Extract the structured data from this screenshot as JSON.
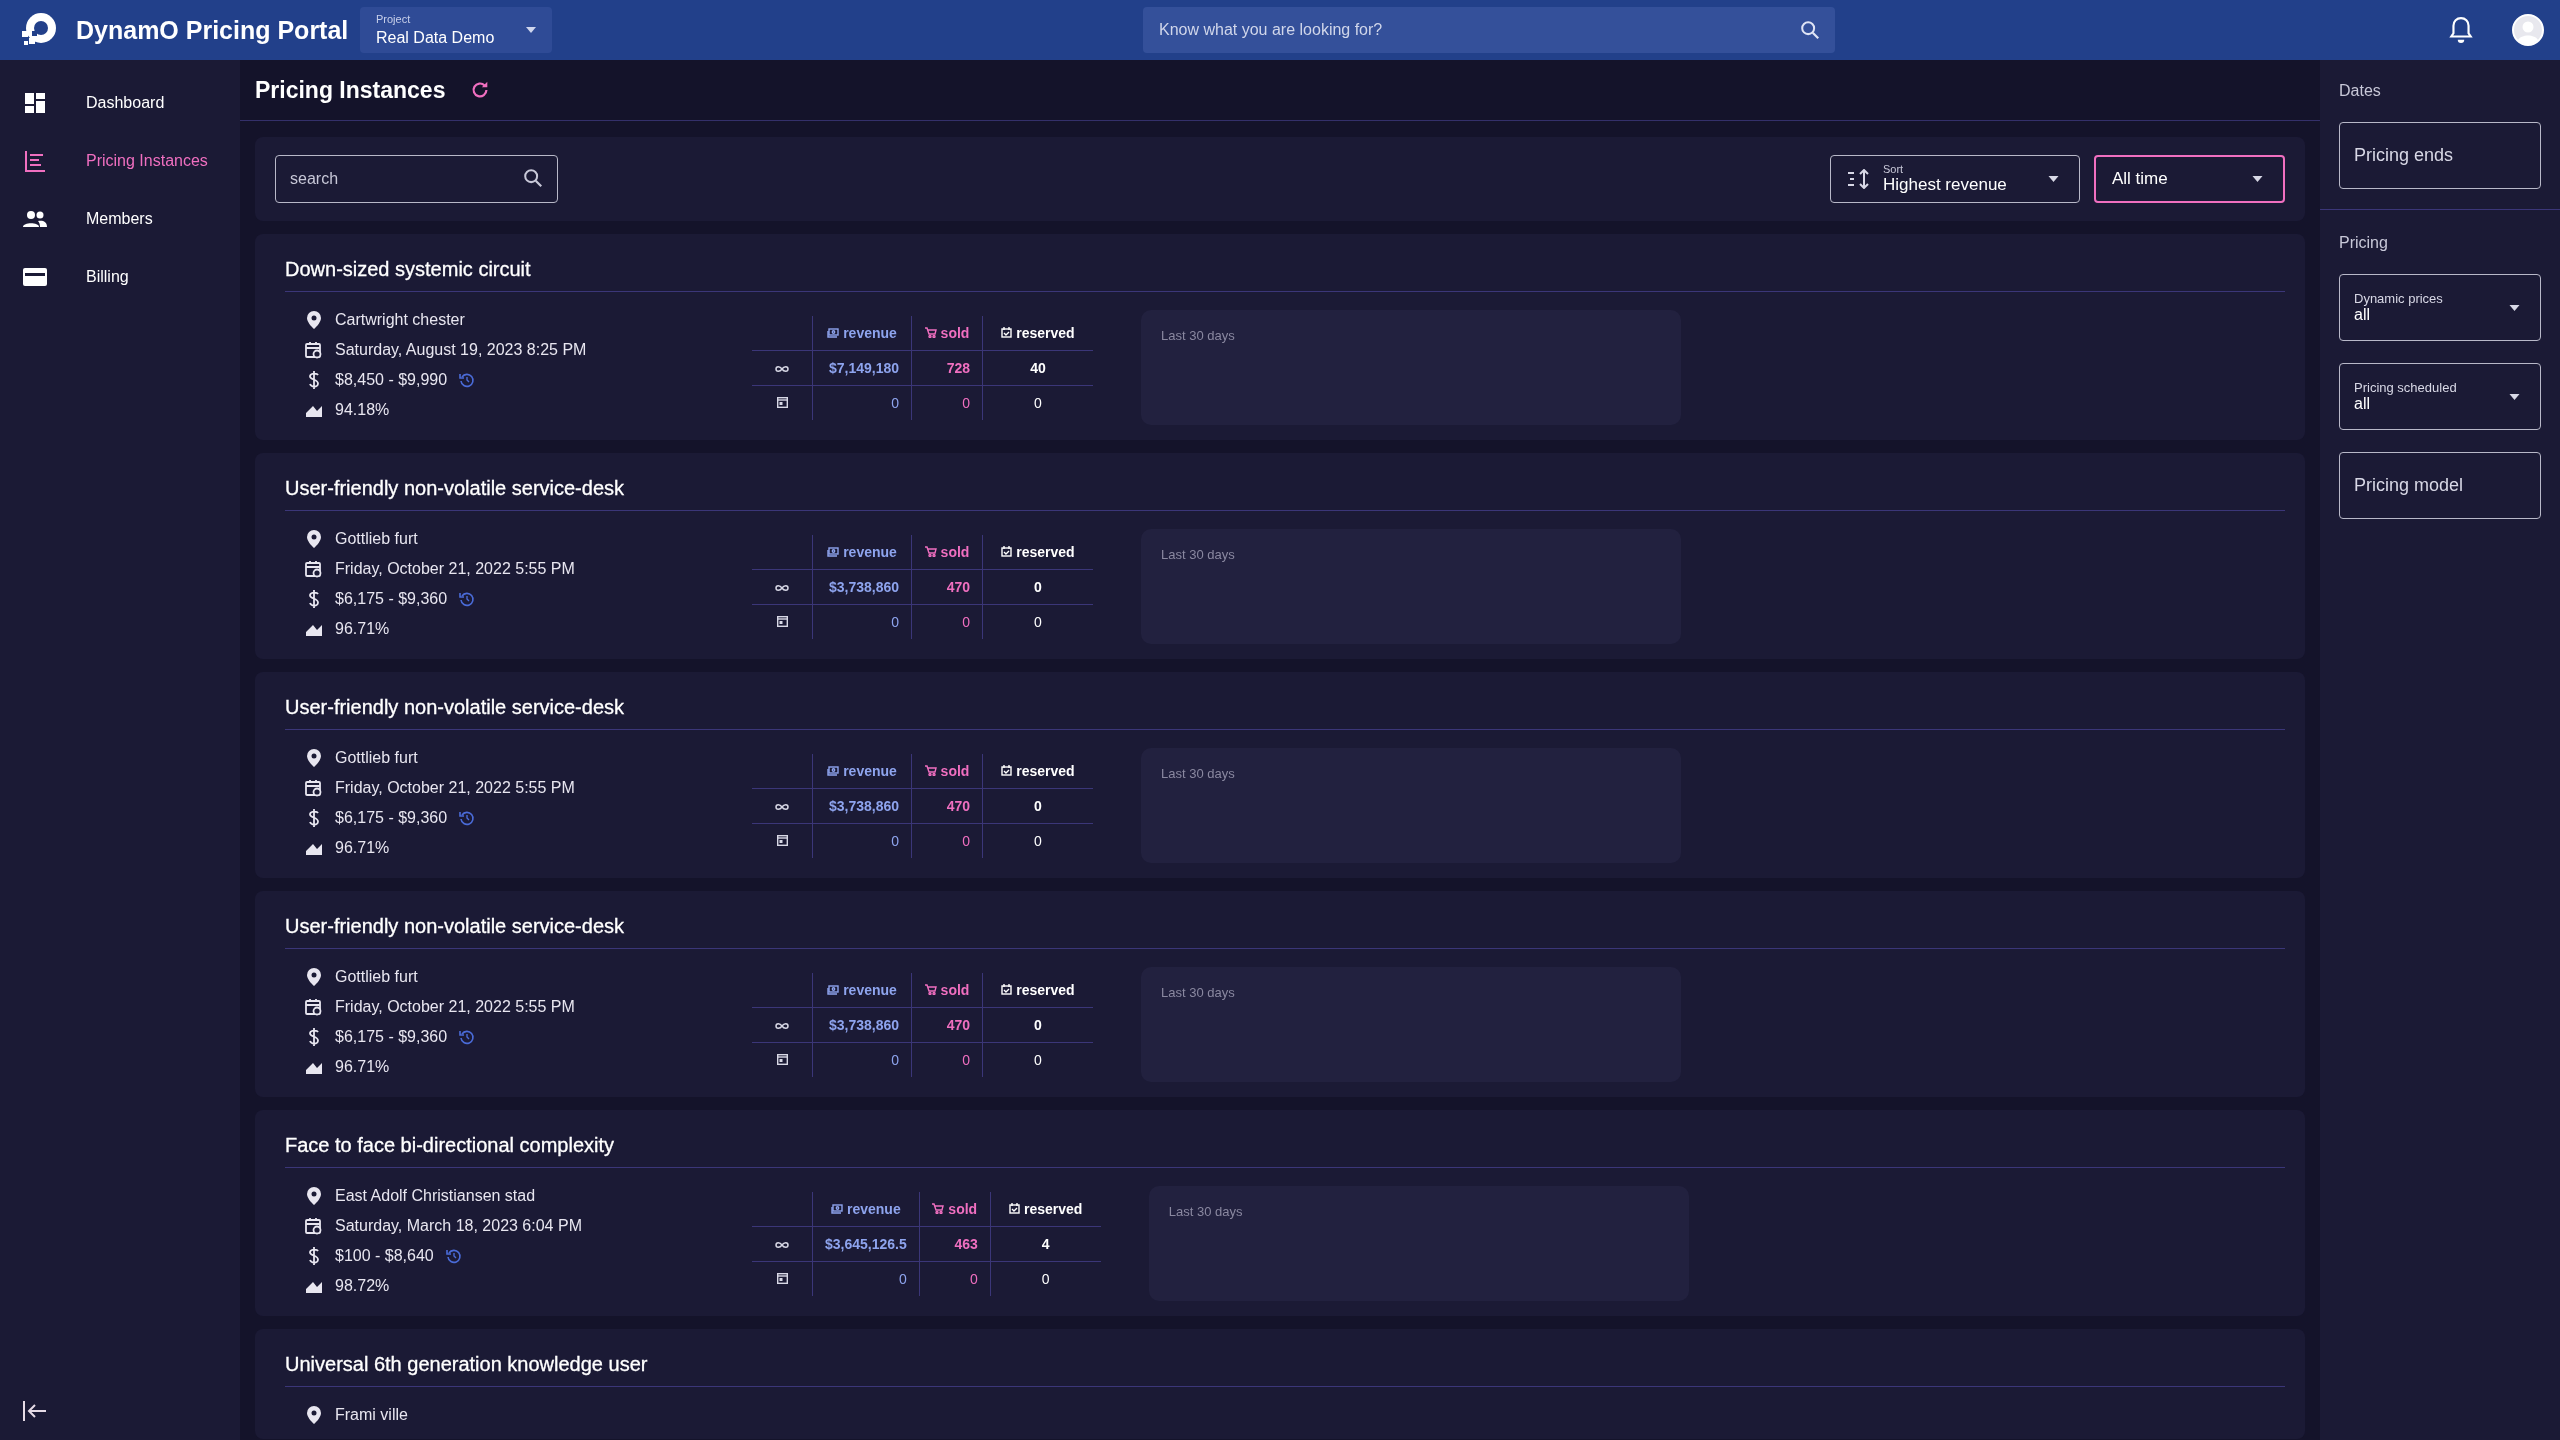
{
  "header": {
    "app_name": "DynamO Pricing Portal",
    "project": {
      "label": "Project",
      "value": "Real Data Demo"
    },
    "search": {
      "placeholder": "Know what you are looking for?"
    }
  },
  "sidebar": {
    "items": [
      {
        "label": "Dashboard",
        "selected": false
      },
      {
        "label": "Pricing Instances",
        "selected": true
      },
      {
        "label": "Members",
        "selected": false
      },
      {
        "label": "Billing",
        "selected": false
      }
    ]
  },
  "page": {
    "title": "Pricing Instances"
  },
  "toolbar": {
    "search": {
      "placeholder": "search"
    },
    "sort": {
      "label": "Sort",
      "value": "Highest revenue",
      "focused": false
    },
    "period": {
      "value": "All time",
      "focused": true
    }
  },
  "instances": [
    {
      "title": "Down-sized systemic circuit",
      "location": "Cartwright chester",
      "date": "Saturday, August 19, 2023 8:25 PM",
      "price": "$8,450 - $9,990",
      "percent": "94.18%",
      "columns": [
        "revenue",
        "sold",
        "reserved"
      ],
      "chart_label": "Last 30 days",
      "rows": [
        {
          "kind": "all",
          "cells": [
            "$7,149,180",
            "728",
            "40"
          ]
        },
        {
          "kind": "scheduled",
          "cells": [
            "0",
            "0",
            "0"
          ]
        }
      ]
    },
    {
      "title": "User-friendly non-volatile service-desk",
      "location": "Gottlieb furt",
      "date": "Friday, October 21, 2022 5:55 PM",
      "price": "$6,175 - $9,360",
      "percent": "96.71%",
      "columns": [
        "revenue",
        "sold",
        "reserved"
      ],
      "chart_label": "Last 30 days",
      "rows": [
        {
          "kind": "all",
          "cells": [
            "$3,738,860",
            "470",
            "0"
          ]
        },
        {
          "kind": "scheduled",
          "cells": [
            "0",
            "0",
            "0"
          ]
        }
      ]
    },
    {
      "title": "User-friendly non-volatile service-desk",
      "location": "Gottlieb furt",
      "date": "Friday, October 21, 2022 5:55 PM",
      "price": "$6,175 - $9,360",
      "percent": "96.71%",
      "columns": [
        "revenue",
        "sold",
        "reserved"
      ],
      "chart_label": "Last 30 days",
      "rows": [
        {
          "kind": "all",
          "cells": [
            "$3,738,860",
            "470",
            "0"
          ]
        },
        {
          "kind": "scheduled",
          "cells": [
            "0",
            "0",
            "0"
          ]
        }
      ]
    },
    {
      "title": "User-friendly non-volatile service-desk",
      "location": "Gottlieb furt",
      "date": "Friday, October 21, 2022 5:55 PM",
      "price": "$6,175 - $9,360",
      "percent": "96.71%",
      "columns": [
        "revenue",
        "sold",
        "reserved"
      ],
      "chart_label": "Last 30 days",
      "rows": [
        {
          "kind": "all",
          "cells": [
            "$3,738,860",
            "470",
            "0"
          ]
        },
        {
          "kind": "scheduled",
          "cells": [
            "0",
            "0",
            "0"
          ]
        }
      ]
    },
    {
      "title": "Face to face bi-directional complexity",
      "location": "East Adolf Christiansen stad",
      "date": "Saturday, March 18, 2023 6:04 PM",
      "price": "$100 - $8,640",
      "percent": "98.72%",
      "columns": [
        "revenue",
        "sold",
        "reserved"
      ],
      "chart_label": "Last 30 days",
      "rows": [
        {
          "kind": "all",
          "cells": [
            "$3,645,126.5",
            "463",
            "4"
          ]
        },
        {
          "kind": "scheduled",
          "cells": [
            "0",
            "0",
            "0"
          ]
        }
      ]
    },
    {
      "title": "Universal 6th generation knowledge user",
      "location": "Frami ville"
    }
  ],
  "filters": {
    "sections": [
      {
        "title": "Dates",
        "fields": [
          {
            "kind": "input",
            "placeholder": "Pricing ends"
          }
        ]
      },
      {
        "title": "Pricing",
        "fields": [
          {
            "kind": "select",
            "label": "Dynamic prices",
            "value": "all"
          },
          {
            "kind": "select",
            "label": "Pricing scheduled",
            "value": "all"
          },
          {
            "kind": "input",
            "placeholder": "Pricing model"
          }
        ]
      }
    ]
  }
}
